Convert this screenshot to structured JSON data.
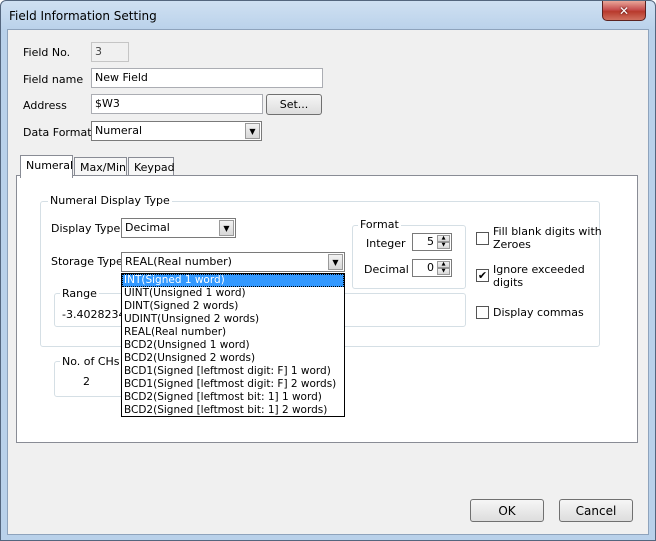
{
  "window": {
    "title": "Field Information Setting",
    "close_glyph": "✕"
  },
  "field_no": {
    "label": "Field No.",
    "value": "3"
  },
  "field_name": {
    "label": "Field name",
    "value": "New Field"
  },
  "address": {
    "label": "Address",
    "value": "$W3",
    "set_button": "Set..."
  },
  "data_format": {
    "label": "Data Format",
    "value": "Numeral"
  },
  "tabs": [
    {
      "label": "Numeral",
      "active": true
    },
    {
      "label": "Max/Min"
    },
    {
      "label": "Keypad"
    }
  ],
  "numeral_group": {
    "title": "Numeral Display Type",
    "display_type_label": "Display Type",
    "display_type_value": "Decimal",
    "storage_type_label": "Storage Type",
    "storage_type_value": "REAL(Real number)"
  },
  "format_group": {
    "title": "Format",
    "integer_label": "Integer",
    "integer_value": "5",
    "decimal_label": "Decimal",
    "decimal_value": "0"
  },
  "range_group": {
    "title": "Range",
    "value": "-3.40282346"
  },
  "channels_group": {
    "title": "No. of CHs",
    "value": "2"
  },
  "options": {
    "fill_blank": {
      "label_line1": "Fill blank digits with",
      "label_line2": "Zeroes",
      "checked": false
    },
    "ignore_exceeded": {
      "label_line1": "Ignore exceeded",
      "label_line2": "digits",
      "checked": true
    },
    "display_commas": {
      "label": "Display commas",
      "checked": false
    }
  },
  "storage_options": [
    "INT(Signed 1 word)",
    "UINT(Unsigned 1 word)",
    "DINT(Signed 2 words)",
    "UDINT(Unsigned 2 words)",
    "REAL(Real number)",
    "BCD2(Unsigned 1 word)",
    "BCD2(Unsigned 2 words)",
    "BCD1(Signed [leftmost digit: F] 1 word)",
    "BCD1(Signed [leftmost digit: F] 2 words)",
    "BCD2(Signed [leftmost bit: 1] 1 word)",
    "BCD2(Signed [leftmost bit: 1] 2 words)"
  ],
  "footer": {
    "ok": "OK",
    "cancel": "Cancel"
  },
  "icons": {
    "dropdown_arrow": "▼",
    "spin_up": "▲",
    "spin_down": "▼",
    "check_mark": "✔"
  },
  "colors": {
    "selection": "#3399ff",
    "close": "#c75050"
  }
}
